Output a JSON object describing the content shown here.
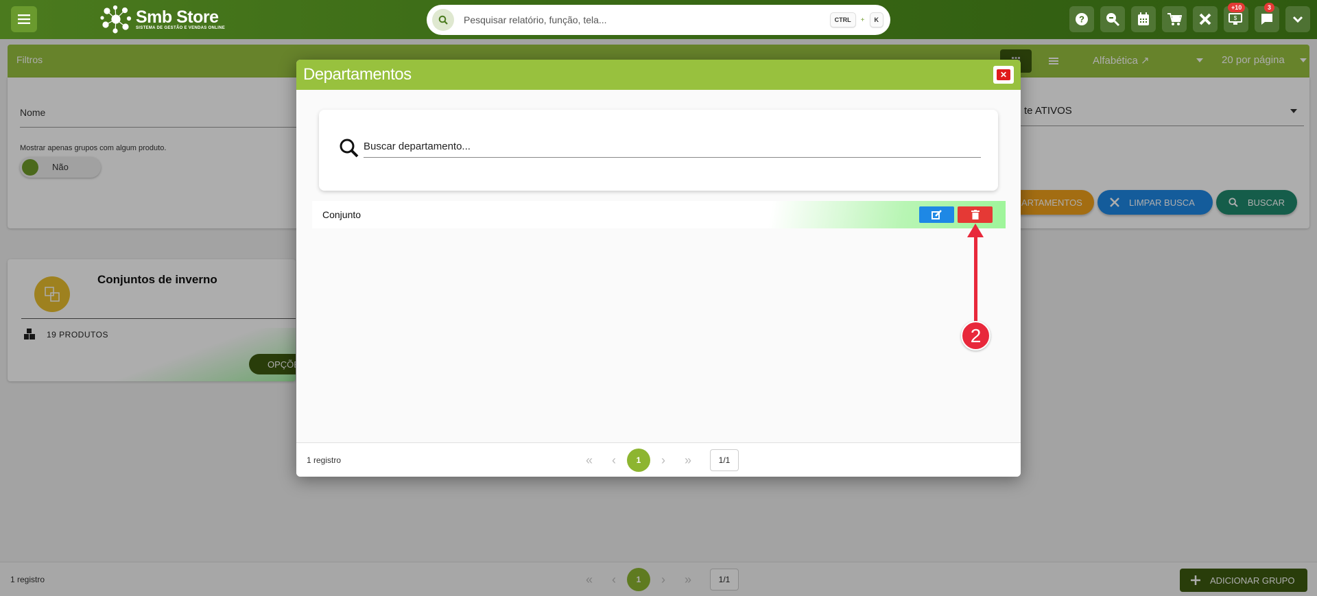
{
  "topbar": {
    "brand_title": "Smb Store",
    "brand_subtitle": "SISTEMA DE GESTÃO E VENDAS ONLINE",
    "search_placeholder": "Pesquisar relatório, função, tela...",
    "shortcut_key1": "CTRL",
    "shortcut_plus": "+",
    "shortcut_key2": "K",
    "badge_monitor": "+10",
    "badge_chat": "3",
    "icons": [
      "help-icon",
      "zoom-search-icon",
      "calendar-icon",
      "cart-icon",
      "tools-icon",
      "monitor-icon",
      "chat-icon",
      "chevron-down-icon"
    ]
  },
  "filters": {
    "title": "Filtros",
    "name_label": "Nome",
    "only_groups_label": "Mostrar apenas grupos com algum produto.",
    "toggle_label": "Não",
    "status_value": "te ATIVOS",
    "sort_value": "Alfabética ↗",
    "perpage_value": "20 por página",
    "departments_button": "ARTAMENTOS",
    "clear_button": "LIMPAR BUSCA",
    "search_button": "BUSCAR"
  },
  "group_card": {
    "title": "Conjuntos de inverno",
    "count": "19 PRODUTOS",
    "options_button": "OPÇÕES"
  },
  "footer": {
    "records": "1 registro",
    "current_page": "1",
    "page_box": "1/1",
    "add_button": "ADICIONAR GRUPO"
  },
  "modal": {
    "title": "Departamentos",
    "close_label": "✕",
    "search_placeholder": "Buscar departamento...",
    "rows": [
      {
        "name": "Conjunto"
      }
    ],
    "records": "1 registro",
    "current_page": "1",
    "page_box": "1/1"
  },
  "annotation": {
    "step": "2"
  },
  "colors": {
    "brand_green": "#98c13e",
    "dark_green": "#3d5a10",
    "edit_blue": "#1e88e5",
    "delete_red": "#e53935",
    "annotation_red": "#e8283b"
  }
}
